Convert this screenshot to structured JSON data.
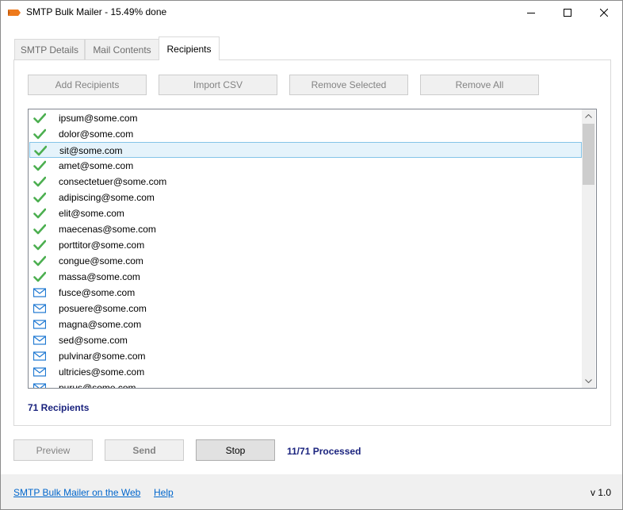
{
  "window": {
    "title": "SMTP Bulk Mailer - 15.49% done",
    "controls": [
      "minimize-icon",
      "maximize-icon",
      "close-icon"
    ]
  },
  "tabs": [
    {
      "label": "SMTP Details",
      "active": false
    },
    {
      "label": "Mail Contents",
      "active": false
    },
    {
      "label": "Recipients",
      "active": true
    }
  ],
  "toolbar": {
    "add_label": "Add Recipients",
    "import_label": "Import CSV",
    "remove_selected_label": "Remove Selected",
    "remove_all_label": "Remove All"
  },
  "recipients": [
    {
      "email": "ipsum@some.com",
      "status": "sent",
      "icon": "check-icon"
    },
    {
      "email": "dolor@some.com",
      "status": "sent",
      "icon": "check-icon"
    },
    {
      "email": "sit@some.com",
      "status": "sent",
      "icon": "check-icon",
      "selected": true
    },
    {
      "email": "amet@some.com",
      "status": "sent",
      "icon": "check-icon"
    },
    {
      "email": "consectetuer@some.com",
      "status": "sent",
      "icon": "check-icon"
    },
    {
      "email": "adipiscing@some.com",
      "status": "sent",
      "icon": "check-icon"
    },
    {
      "email": "elit@some.com",
      "status": "sent",
      "icon": "check-icon"
    },
    {
      "email": "maecenas@some.com",
      "status": "sent",
      "icon": "check-icon"
    },
    {
      "email": "porttitor@some.com",
      "status": "sent",
      "icon": "check-icon"
    },
    {
      "email": "congue@some.com",
      "status": "sent",
      "icon": "check-icon"
    },
    {
      "email": "massa@some.com",
      "status": "sent",
      "icon": "check-icon"
    },
    {
      "email": "fusce@some.com",
      "status": "pending",
      "icon": "envelope-icon"
    },
    {
      "email": "posuere@some.com",
      "status": "pending",
      "icon": "envelope-icon"
    },
    {
      "email": "magna@some.com",
      "status": "pending",
      "icon": "envelope-icon"
    },
    {
      "email": "sed@some.com",
      "status": "pending",
      "icon": "envelope-icon"
    },
    {
      "email": "pulvinar@some.com",
      "status": "pending",
      "icon": "envelope-icon"
    },
    {
      "email": "ultricies@some.com",
      "status": "pending",
      "icon": "envelope-icon"
    },
    {
      "email": "purus@some.com",
      "status": "pending",
      "icon": "envelope-icon"
    }
  ],
  "recipient_count": "71 Recipients",
  "actions": {
    "preview_label": "Preview",
    "send_label": "Send",
    "stop_label": "Stop",
    "processed": "11/71 Processed"
  },
  "footer": {
    "web_link": "SMTP Bulk Mailer on the Web",
    "help_link": "Help",
    "version": "v 1.0"
  },
  "colors": {
    "check": "#4caf50",
    "envelope": "#1e78d2",
    "selection": "#e5f3fb",
    "status_text": "#1a237e",
    "link": "#0066cc"
  }
}
